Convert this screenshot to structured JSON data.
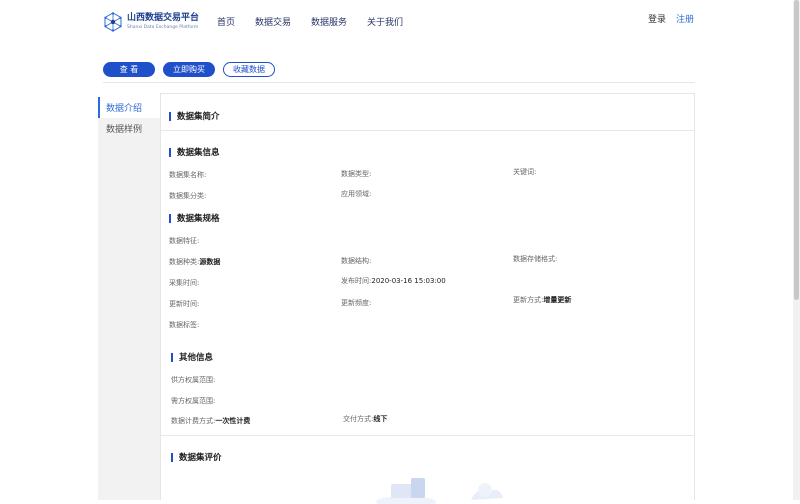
{
  "brand": {
    "title": "山西数据交易平台",
    "subtitle": "Shanxi Data Exchange Platform"
  },
  "nav": {
    "items": [
      "首页",
      "数据交易",
      "数据服务",
      "关于我们"
    ]
  },
  "auth": {
    "login": "登录",
    "register": "注册"
  },
  "actions": {
    "view": "查 看",
    "buy": "立即购买",
    "favorite": "收藏数据"
  },
  "side": {
    "items": [
      "数据介绍",
      "数据样例"
    ]
  },
  "sections": {
    "intro": "数据集简介",
    "info": "数据集信息",
    "spec": "数据集规格",
    "other": "其他信息",
    "review": "数据集评价"
  },
  "info": {
    "name_label": "数据集名称:",
    "type_label": "数据类型:",
    "keywords_label": "关键词:",
    "category_label": "数据集分类:",
    "domain_label": "应用领域:"
  },
  "spec": {
    "feature_label": "数据特征:",
    "kind_label": "数据种类:",
    "kind_value": "源数据",
    "structure_label": "数据结构:",
    "storage_label": "数据存储格式:",
    "collect_label": "采集时间:",
    "publish_label": "发布时间:",
    "publish_value": "2020-03-16 15:03:00",
    "update_label": "更新时间:",
    "frequency_label": "更新频度:",
    "mode_label": "更新方式:",
    "mode_value": "增量更新",
    "tags_label": "数据标签:"
  },
  "other": {
    "supply_label": "供方权属范围:",
    "demand_label": "需方权属范围:",
    "billing_label": "数据计费方式:",
    "billing_value": "一次性计费",
    "delivery_label": "交付方式:",
    "delivery_value": "线下"
  },
  "colors": {
    "primary": "#1f4fc9",
    "link": "#2f6bd8",
    "brand": "#1f3f8f"
  }
}
